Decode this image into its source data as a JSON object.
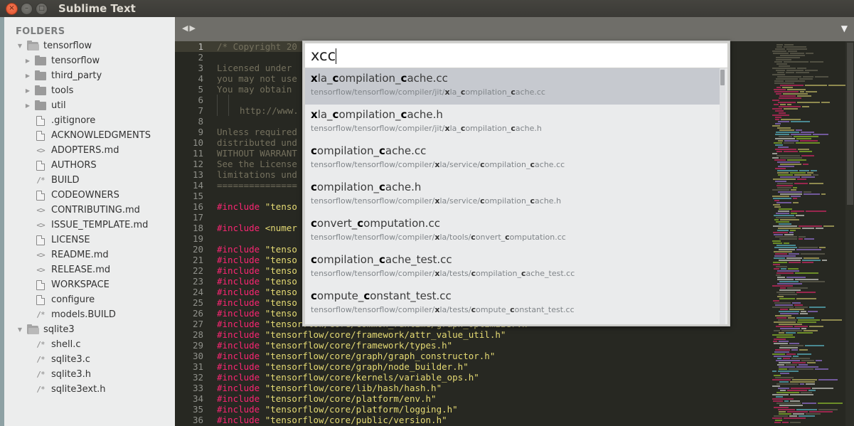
{
  "window": {
    "title": "Sublime Text",
    "buttons": {
      "close": "×",
      "minimize": "–",
      "maximize": "□"
    }
  },
  "sidebar": {
    "heading": "FOLDERS",
    "tree": [
      {
        "label": "tensorflow",
        "type": "folder-open",
        "level": 0
      },
      {
        "label": "tensorflow",
        "type": "folder",
        "level": 1
      },
      {
        "label": "third_party",
        "type": "folder",
        "level": 1
      },
      {
        "label": "tools",
        "type": "folder",
        "level": 1
      },
      {
        "label": "util",
        "type": "folder",
        "level": 1
      },
      {
        "label": ".gitignore",
        "type": "file-doc",
        "level": 1
      },
      {
        "label": "ACKNOWLEDGMENTS",
        "type": "file-doc",
        "level": 1
      },
      {
        "label": "ADOPTERS.md",
        "type": "file-markup",
        "level": 1
      },
      {
        "label": "AUTHORS",
        "type": "file-doc",
        "level": 1
      },
      {
        "label": "BUILD",
        "type": "file-comment",
        "level": 1
      },
      {
        "label": "CODEOWNERS",
        "type": "file-doc",
        "level": 1
      },
      {
        "label": "CONTRIBUTING.md",
        "type": "file-markup",
        "level": 1
      },
      {
        "label": "ISSUE_TEMPLATE.md",
        "type": "file-markup",
        "level": 1
      },
      {
        "label": "LICENSE",
        "type": "file-doc",
        "level": 1
      },
      {
        "label": "README.md",
        "type": "file-markup",
        "level": 1
      },
      {
        "label": "RELEASE.md",
        "type": "file-markup",
        "level": 1
      },
      {
        "label": "WORKSPACE",
        "type": "file-doc",
        "level": 1
      },
      {
        "label": "configure",
        "type": "file-doc",
        "level": 1
      },
      {
        "label": "models.BUILD",
        "type": "file-comment",
        "level": 1
      },
      {
        "label": "sqlite3",
        "type": "folder-open",
        "level": 0
      },
      {
        "label": "shell.c",
        "type": "file-comment",
        "level": 1
      },
      {
        "label": "sqlite3.c",
        "type": "file-comment",
        "level": 1
      },
      {
        "label": "sqlite3.h",
        "type": "file-comment",
        "level": 1
      },
      {
        "label": "sqlite3ext.h",
        "type": "file-comment",
        "level": 1
      }
    ],
    "icons": {
      "arrow_right": "▶",
      "arrow_down": "▼",
      "file_markup": "<>",
      "file_comment": "/*"
    }
  },
  "tabbar": {
    "nav_back": "◀",
    "nav_forward": "▶",
    "menu": "▼"
  },
  "editor": {
    "active_line": 1,
    "lines": [
      {
        "n": "1",
        "parts": [
          [
            "cmt",
            "/* Copyright 20"
          ]
        ]
      },
      {
        "n": "2",
        "parts": []
      },
      {
        "n": "3",
        "parts": [
          [
            "cmt",
            "Licensed under "
          ]
        ]
      },
      {
        "n": "4",
        "parts": [
          [
            "cmt",
            "you may not use"
          ]
        ]
      },
      {
        "n": "5",
        "parts": [
          [
            "cmt",
            "You may obtain "
          ]
        ]
      },
      {
        "n": "6",
        "parts": [
          [
            "guide",
            ""
          ],
          [
            "guide",
            ""
          ]
        ]
      },
      {
        "n": "7",
        "parts": [
          [
            "guide",
            ""
          ],
          [
            "guide",
            ""
          ],
          [
            "cmt",
            "http://www."
          ]
        ]
      },
      {
        "n": "8",
        "parts": []
      },
      {
        "n": "9",
        "parts": [
          [
            "cmt",
            "Unless required"
          ]
        ]
      },
      {
        "n": "10",
        "parts": [
          [
            "cmt",
            "distributed und"
          ]
        ]
      },
      {
        "n": "11",
        "parts": [
          [
            "cmt",
            "WITHOUT WARRANT"
          ]
        ]
      },
      {
        "n": "12",
        "parts": [
          [
            "cmt",
            "See the License"
          ]
        ]
      },
      {
        "n": "13",
        "parts": [
          [
            "cmt",
            "limitations und"
          ]
        ]
      },
      {
        "n": "14",
        "parts": [
          [
            "cmt",
            "==============="
          ]
        ]
      },
      {
        "n": "15",
        "parts": []
      },
      {
        "n": "16",
        "parts": [
          [
            "kw",
            "#include"
          ],
          [
            "txt",
            " "
          ],
          [
            "str",
            "\"tenso"
          ]
        ]
      },
      {
        "n": "17",
        "parts": []
      },
      {
        "n": "18",
        "parts": [
          [
            "kw",
            "#include"
          ],
          [
            "txt",
            " "
          ],
          [
            "str",
            "<numer"
          ]
        ]
      },
      {
        "n": "19",
        "parts": []
      },
      {
        "n": "20",
        "parts": [
          [
            "kw",
            "#include"
          ],
          [
            "txt",
            " "
          ],
          [
            "str",
            "\"tenso"
          ]
        ]
      },
      {
        "n": "21",
        "parts": [
          [
            "kw",
            "#include"
          ],
          [
            "txt",
            " "
          ],
          [
            "str",
            "\"tenso"
          ]
        ]
      },
      {
        "n": "22",
        "parts": [
          [
            "kw",
            "#include"
          ],
          [
            "txt",
            " "
          ],
          [
            "str",
            "\"tenso"
          ]
        ]
      },
      {
        "n": "23",
        "parts": [
          [
            "kw",
            "#include"
          ],
          [
            "txt",
            " "
          ],
          [
            "str",
            "\"tenso"
          ]
        ]
      },
      {
        "n": "24",
        "parts": [
          [
            "kw",
            "#include"
          ],
          [
            "txt",
            " "
          ],
          [
            "str",
            "\"tenso"
          ]
        ]
      },
      {
        "n": "25",
        "parts": [
          [
            "kw",
            "#include"
          ],
          [
            "txt",
            " "
          ],
          [
            "str",
            "\"tenso"
          ]
        ]
      },
      {
        "n": "26",
        "parts": [
          [
            "kw",
            "#include"
          ],
          [
            "txt",
            " "
          ],
          [
            "str",
            "\"tenso"
          ]
        ]
      },
      {
        "n": "27",
        "parts": [
          [
            "kw",
            "#include"
          ],
          [
            "txt",
            " "
          ],
          [
            "str",
            "\"tensorflow/core/common_runtime/graph_optimizer.h\""
          ]
        ]
      },
      {
        "n": "28",
        "parts": [
          [
            "kw",
            "#include"
          ],
          [
            "txt",
            " "
          ],
          [
            "str",
            "\"tensorflow/core/framework/attr_value_util.h\""
          ]
        ]
      },
      {
        "n": "29",
        "parts": [
          [
            "kw",
            "#include"
          ],
          [
            "txt",
            " "
          ],
          [
            "str",
            "\"tensorflow/core/framework/types.h\""
          ]
        ]
      },
      {
        "n": "30",
        "parts": [
          [
            "kw",
            "#include"
          ],
          [
            "txt",
            " "
          ],
          [
            "str",
            "\"tensorflow/core/graph/graph_constructor.h\""
          ]
        ]
      },
      {
        "n": "31",
        "parts": [
          [
            "kw",
            "#include"
          ],
          [
            "txt",
            " "
          ],
          [
            "str",
            "\"tensorflow/core/graph/node_builder.h\""
          ]
        ]
      },
      {
        "n": "32",
        "parts": [
          [
            "kw",
            "#include"
          ],
          [
            "txt",
            " "
          ],
          [
            "str",
            "\"tensorflow/core/kernels/variable_ops.h\""
          ]
        ]
      },
      {
        "n": "33",
        "parts": [
          [
            "kw",
            "#include"
          ],
          [
            "txt",
            " "
          ],
          [
            "str",
            "\"tensorflow/core/lib/hash/hash.h\""
          ]
        ]
      },
      {
        "n": "34",
        "parts": [
          [
            "kw",
            "#include"
          ],
          [
            "txt",
            " "
          ],
          [
            "str",
            "\"tensorflow/core/platform/env.h\""
          ]
        ]
      },
      {
        "n": "35",
        "parts": [
          [
            "kw",
            "#include"
          ],
          [
            "txt",
            " "
          ],
          [
            "str",
            "\"tensorflow/core/platform/logging.h\""
          ]
        ]
      },
      {
        "n": "36",
        "parts": [
          [
            "kw",
            "#include"
          ],
          [
            "txt",
            " "
          ],
          [
            "str",
            "\"tensorflow/core/public/version.h\""
          ]
        ]
      }
    ]
  },
  "goto_anything": {
    "query": "xcc",
    "selected_index": 0,
    "results": [
      {
        "title": [
          [
            "b",
            "x"
          ],
          [
            "t",
            "la_"
          ],
          [
            "b",
            "c"
          ],
          [
            "t",
            "ompilation_"
          ],
          [
            "b",
            "c"
          ],
          [
            "t",
            "ache.cc"
          ]
        ],
        "path": [
          [
            "t",
            "tensorflow/tensorflow/compiler/jit/"
          ],
          [
            "b",
            "x"
          ],
          [
            "t",
            "la_"
          ],
          [
            "b",
            "c"
          ],
          [
            "t",
            "ompilation_"
          ],
          [
            "b",
            "c"
          ],
          [
            "t",
            "ache.cc"
          ]
        ]
      },
      {
        "title": [
          [
            "b",
            "x"
          ],
          [
            "t",
            "la_"
          ],
          [
            "b",
            "c"
          ],
          [
            "t",
            "ompilation_"
          ],
          [
            "b",
            "c"
          ],
          [
            "t",
            "ache.h"
          ]
        ],
        "path": [
          [
            "t",
            "tensorflow/tensorflow/compiler/jit/"
          ],
          [
            "b",
            "x"
          ],
          [
            "t",
            "la_"
          ],
          [
            "b",
            "c"
          ],
          [
            "t",
            "ompilation_"
          ],
          [
            "b",
            "c"
          ],
          [
            "t",
            "ache.h"
          ]
        ]
      },
      {
        "title": [
          [
            "b",
            "c"
          ],
          [
            "t",
            "ompilation_"
          ],
          [
            "b",
            "c"
          ],
          [
            "t",
            "ache.cc"
          ]
        ],
        "path": [
          [
            "t",
            "tensorflow/tensorflow/compiler/"
          ],
          [
            "b",
            "x"
          ],
          [
            "t",
            "la/service/"
          ],
          [
            "b",
            "c"
          ],
          [
            "t",
            "ompilation_"
          ],
          [
            "b",
            "c"
          ],
          [
            "t",
            "ache.cc"
          ]
        ]
      },
      {
        "title": [
          [
            "b",
            "c"
          ],
          [
            "t",
            "ompilation_"
          ],
          [
            "b",
            "c"
          ],
          [
            "t",
            "ache.h"
          ]
        ],
        "path": [
          [
            "t",
            "tensorflow/tensorflow/compiler/"
          ],
          [
            "b",
            "x"
          ],
          [
            "t",
            "la/service/"
          ],
          [
            "b",
            "c"
          ],
          [
            "t",
            "ompilation_"
          ],
          [
            "b",
            "c"
          ],
          [
            "t",
            "ache.h"
          ]
        ]
      },
      {
        "title": [
          [
            "b",
            "c"
          ],
          [
            "t",
            "onvert_"
          ],
          [
            "b",
            "c"
          ],
          [
            "t",
            "omputation.cc"
          ]
        ],
        "path": [
          [
            "t",
            "tensorflow/tensorflow/compiler/"
          ],
          [
            "b",
            "x"
          ],
          [
            "t",
            "la/tools/"
          ],
          [
            "b",
            "c"
          ],
          [
            "t",
            "onvert_"
          ],
          [
            "b",
            "c"
          ],
          [
            "t",
            "omputation.cc"
          ]
        ]
      },
      {
        "title": [
          [
            "b",
            "c"
          ],
          [
            "t",
            "ompilation_"
          ],
          [
            "b",
            "c"
          ],
          [
            "t",
            "ache_test.cc"
          ]
        ],
        "path": [
          [
            "t",
            "tensorflow/tensorflow/compiler/"
          ],
          [
            "b",
            "x"
          ],
          [
            "t",
            "la/tests/"
          ],
          [
            "b",
            "c"
          ],
          [
            "t",
            "ompilation_"
          ],
          [
            "b",
            "c"
          ],
          [
            "t",
            "ache_test.cc"
          ]
        ]
      },
      {
        "title": [
          [
            "b",
            "c"
          ],
          [
            "t",
            "ompute_"
          ],
          [
            "b",
            "c"
          ],
          [
            "t",
            "onstant_test.cc"
          ]
        ],
        "path": [
          [
            "t",
            "tensorflow/tensorflow/compiler/"
          ],
          [
            "b",
            "x"
          ],
          [
            "t",
            "la/tests/"
          ],
          [
            "b",
            "c"
          ],
          [
            "t",
            "ompute_"
          ],
          [
            "b",
            "c"
          ],
          [
            "t",
            "onstant_test.cc"
          ]
        ]
      }
    ]
  },
  "colors": {
    "editor_bg": "#272822",
    "comment": "#75715e",
    "keyword": "#f92672",
    "string": "#e6db74",
    "sidebar_bg": "#eceded",
    "selected_result": "#c6c9cf",
    "close_button": "#e2512c"
  }
}
